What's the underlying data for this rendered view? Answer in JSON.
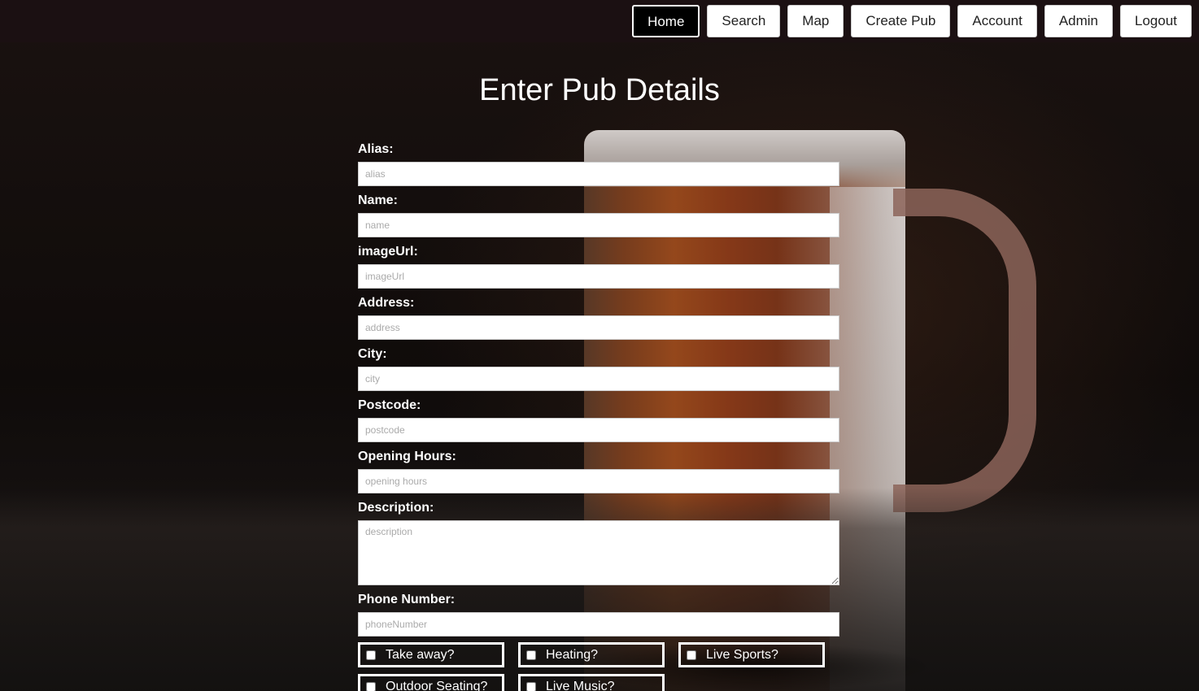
{
  "nav": {
    "items": [
      {
        "label": "Home",
        "active": true
      },
      {
        "label": "Search",
        "active": false
      },
      {
        "label": "Map",
        "active": false
      },
      {
        "label": "Create Pub",
        "active": false
      },
      {
        "label": "Account",
        "active": false
      },
      {
        "label": "Admin",
        "active": false
      },
      {
        "label": "Logout",
        "active": false
      }
    ]
  },
  "form": {
    "title": "Enter Pub Details",
    "fields": {
      "alias": {
        "label": "Alias:",
        "placeholder": "alias",
        "value": ""
      },
      "name": {
        "label": "Name:",
        "placeholder": "name",
        "value": ""
      },
      "imageUrl": {
        "label": "imageUrl:",
        "placeholder": "imageUrl",
        "value": ""
      },
      "address": {
        "label": "Address:",
        "placeholder": "address",
        "value": ""
      },
      "city": {
        "label": "City:",
        "placeholder": "city",
        "value": ""
      },
      "postcode": {
        "label": "Postcode:",
        "placeholder": "postcode",
        "value": ""
      },
      "openingHours": {
        "label": "Opening Hours:",
        "placeholder": "opening hours",
        "value": ""
      },
      "description": {
        "label": "Description:",
        "placeholder": "description",
        "value": ""
      },
      "phoneNumber": {
        "label": "Phone Number:",
        "placeholder": "phoneNumber",
        "value": ""
      }
    },
    "checkboxes": [
      {
        "label": "Take away?",
        "checked": false
      },
      {
        "label": "Heating?",
        "checked": false
      },
      {
        "label": "Live Sports?",
        "checked": false
      },
      {
        "label": "Outdoor Seating?",
        "checked": false
      },
      {
        "label": "Live Music?",
        "checked": false
      }
    ]
  },
  "colors": {
    "navbar_bg": "#1b1012",
    "active_button_bg": "#000000",
    "text": "#ffffff"
  }
}
